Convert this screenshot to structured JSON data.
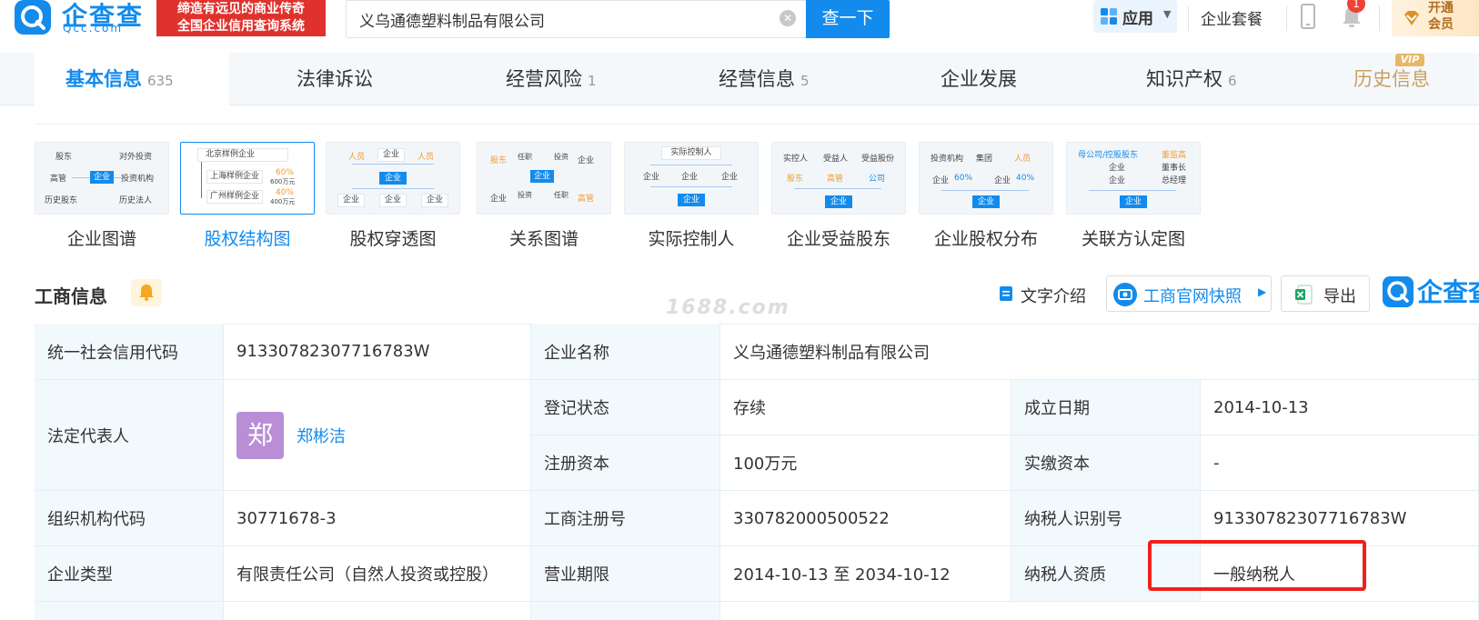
{
  "header": {
    "logo_cn": "企查查",
    "logo_en": "Qcc.com",
    "slogan_line1": "缔造有远见的商业传奇",
    "slogan_line2": "全国企业信用查询系统",
    "search_value": "义乌通德塑料制品有限公司",
    "search_button": "查一下",
    "app_label": "应用",
    "suite_link": "企业套餐",
    "notification_count": "1",
    "vip_line1": "开通",
    "vip_line2": "会员"
  },
  "tabs": [
    {
      "label": "基本信息",
      "count": "635"
    },
    {
      "label": "法律诉讼",
      "count": ""
    },
    {
      "label": "经营风险",
      "count": "1"
    },
    {
      "label": "经营信息",
      "count": "5"
    },
    {
      "label": "企业发展",
      "count": ""
    },
    {
      "label": "知识产权",
      "count": "6"
    },
    {
      "label": "历史信息",
      "count": ""
    }
  ],
  "vip_tag": "VIP",
  "graphs": [
    {
      "label": "企业图谱"
    },
    {
      "label": "股权结构图"
    },
    {
      "label": "股权穿透图"
    },
    {
      "label": "关系图谱"
    },
    {
      "label": "实际控制人"
    },
    {
      "label": "企业受益股东"
    },
    {
      "label": "企业股权分布"
    },
    {
      "label": "关联方认定图"
    }
  ],
  "thumb_text": {
    "t1": {
      "a": "股东",
      "b": "对外投资",
      "c": "高管",
      "d": "企业",
      "e": "投资机构",
      "f": "历史股东",
      "g": "历史法人"
    },
    "t2": {
      "a": "北京样例企业",
      "b": "上海样例企业",
      "c": "广州样例企业",
      "p1": "60%",
      "p1s": "600万元",
      "p2": "40%",
      "p2s": "400万元"
    },
    "t3": {
      "a": "人员",
      "b": "企业",
      "c": "人员",
      "d": "企业",
      "e": "企业",
      "f": "企业",
      "g": "企业"
    },
    "t4": {
      "a": "股东",
      "b": "任职",
      "c": "投资",
      "d": "企业",
      "e": "企业",
      "f": "投资",
      "g": "任职",
      "h": "企业",
      "i": "高管"
    },
    "t5": {
      "a": "实际控制人",
      "b": "企业",
      "c": "企业",
      "d": "企业",
      "e": "企业"
    },
    "t6": {
      "a": "实控人",
      "b": "受益人",
      "c": "受益股份",
      "d": "股东",
      "e": "高管",
      "f": "公司",
      "g": "企业"
    },
    "t7": {
      "a": "投资机构",
      "b": "集团",
      "c": "人员",
      "d": "企业",
      "e": "60%",
      "f": "企业",
      "g": "40%",
      "h": "企业"
    },
    "t8": {
      "a": "母公司/控股股东",
      "b": "董监高",
      "c": "企业",
      "d": "董事长",
      "e": "企业",
      "f": "总经理",
      "g": "企业"
    }
  },
  "section": {
    "title": "工商信息",
    "text_intro": "文字介绍",
    "snapshot": "工商官网快照",
    "export": "导出",
    "brand": "企查查",
    "watermark": "1688.com"
  },
  "info": {
    "credit_code_label": "统一社会信用代码",
    "credit_code": "91330782307716783W",
    "company_name_label": "企业名称",
    "company_name": "义乌通德塑料制品有限公司",
    "legal_rep_label": "法定代表人",
    "legal_rep_avatar": "郑",
    "legal_rep": "郑彬洁",
    "reg_status_label": "登记状态",
    "reg_status": "存续",
    "est_date_label": "成立日期",
    "est_date": "2014-10-13",
    "reg_capital_label": "注册资本",
    "reg_capital": "100万元",
    "paid_capital_label": "实缴资本",
    "paid_capital": "-",
    "org_code_label": "组织机构代码",
    "org_code": "30771678-3",
    "biz_reg_no_label": "工商注册号",
    "biz_reg_no": "330782000500522",
    "taxpayer_id_label": "纳税人识别号",
    "taxpayer_id": "91330782307716783W",
    "company_type_label": "企业类型",
    "company_type": "有限责任公司（自然人投资或控股）",
    "biz_term_label": "营业期限",
    "biz_term": "2014-10-13 至 2034-10-12",
    "taxpayer_qual_label": "纳税人资质",
    "taxpayer_qual": "一般纳税人"
  },
  "colors": {
    "brand": "#128bed",
    "slogan_bg": "#e0322d",
    "label_bg": "#f2f9fc",
    "highlight": "#f0201b"
  }
}
